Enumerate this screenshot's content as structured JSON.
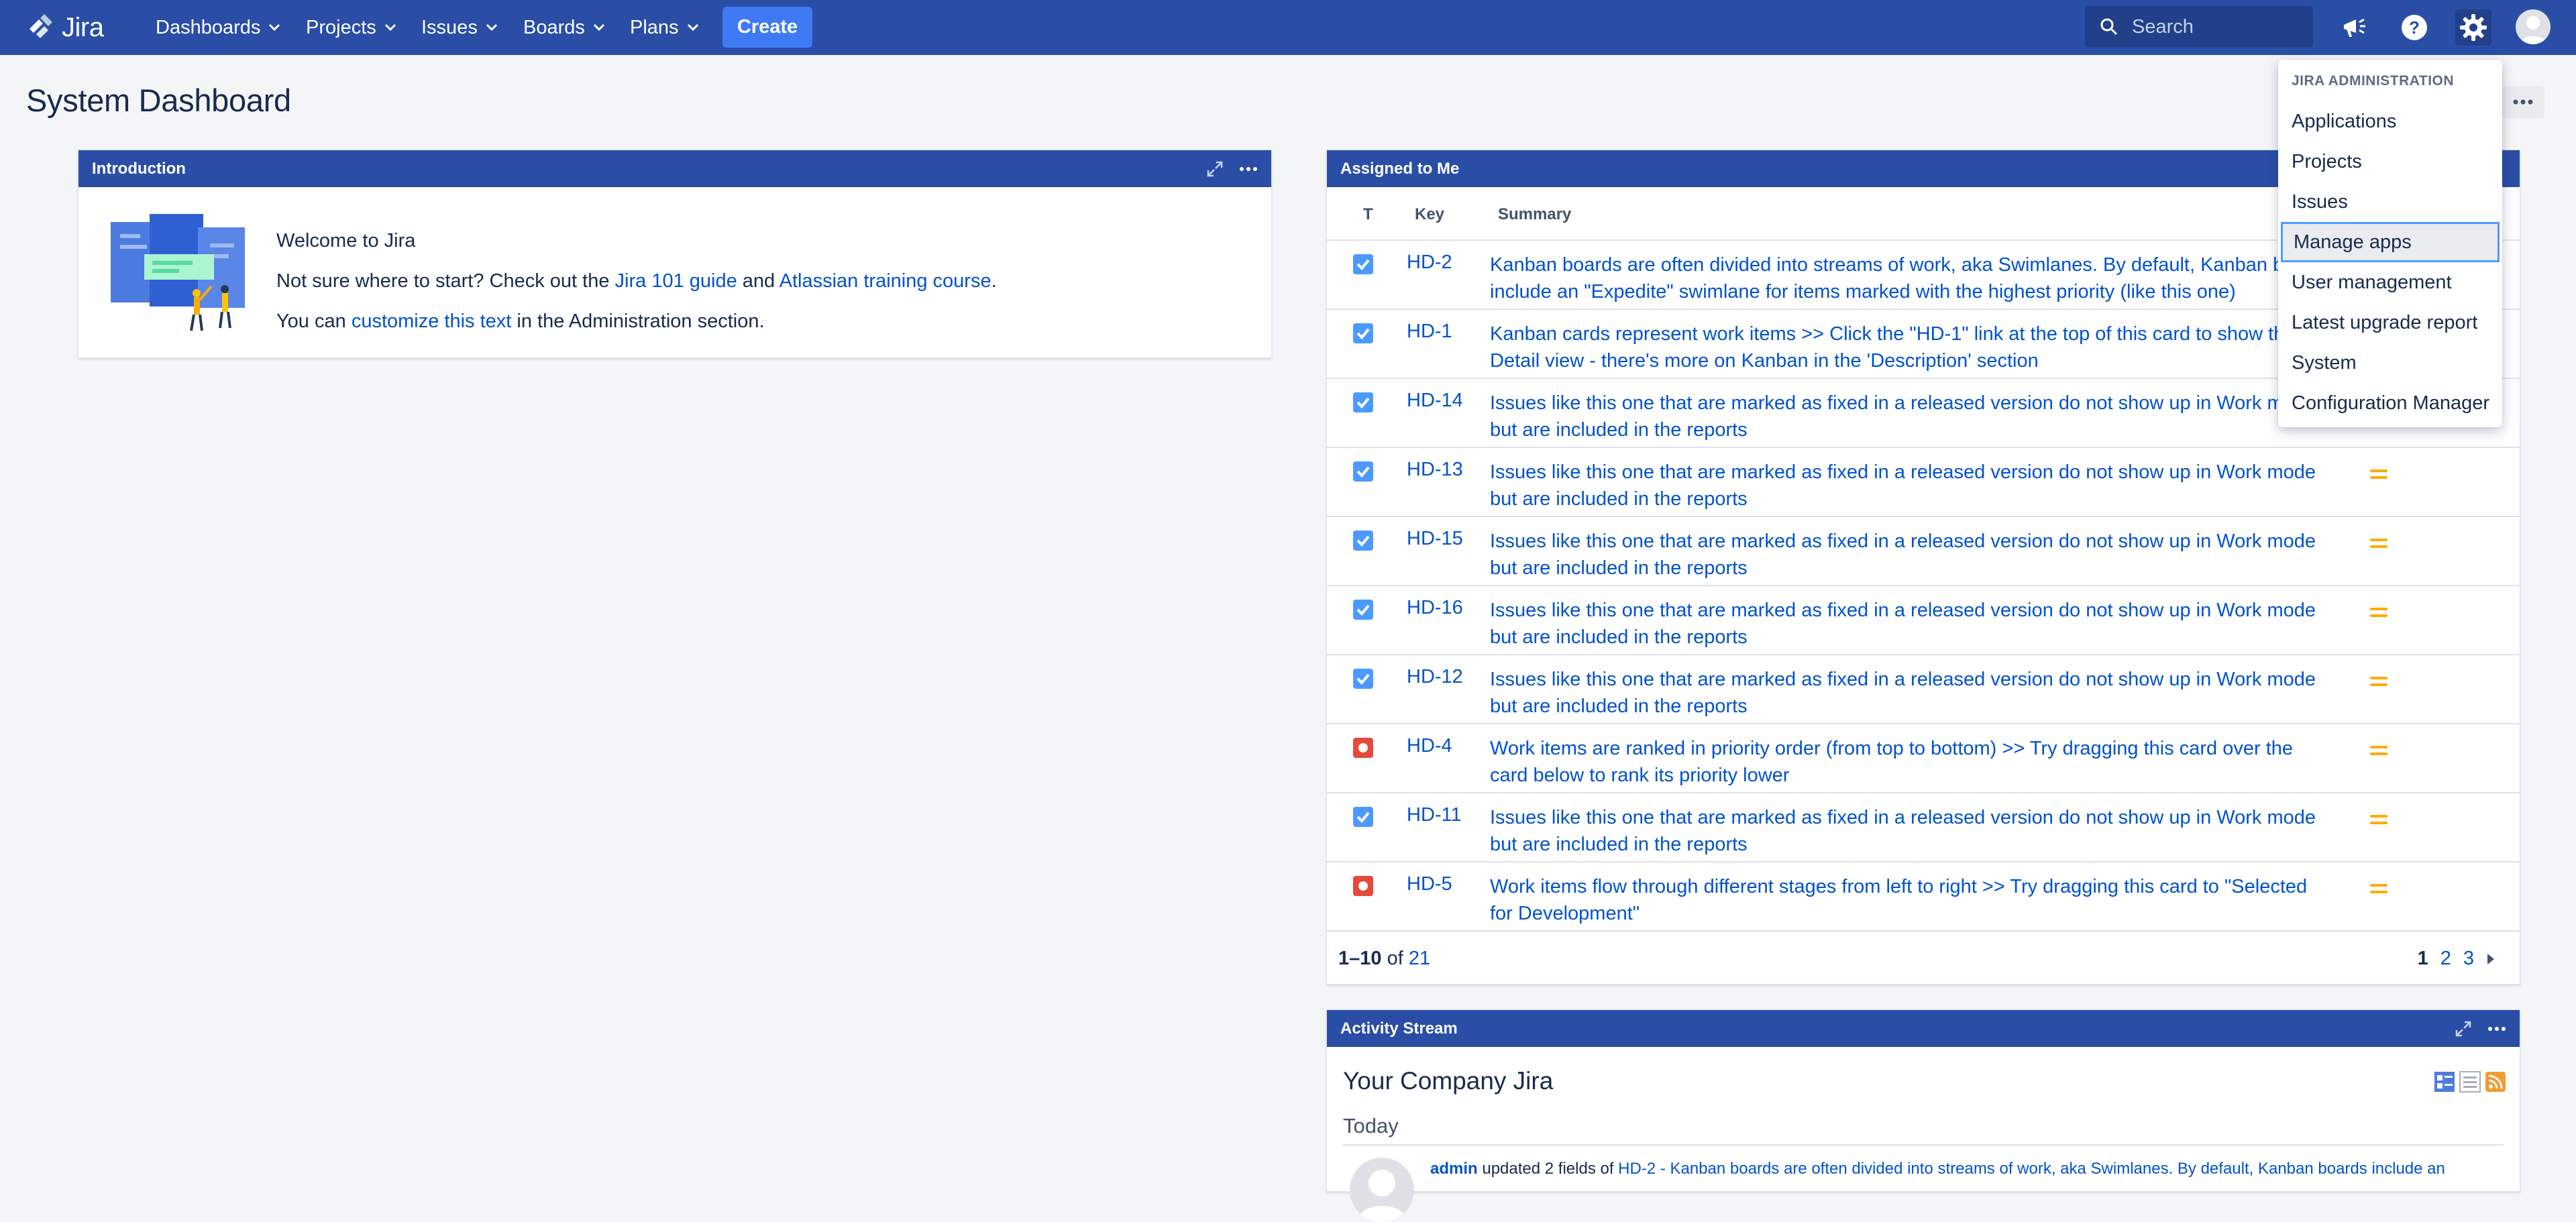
{
  "nav": {
    "product": "Jira",
    "items": [
      {
        "label": "Dashboards"
      },
      {
        "label": "Projects"
      },
      {
        "label": "Issues"
      },
      {
        "label": "Boards"
      },
      {
        "label": "Plans"
      }
    ],
    "create_label": "Create",
    "search_placeholder": "Search"
  },
  "page": {
    "title": "System Dashboard"
  },
  "introduction": {
    "title": "Introduction",
    "welcome": "Welcome to Jira",
    "line2_prefix": "Not sure where to start? Check out the ",
    "link_guide": "Jira 101 guide",
    "line2_mid": " and ",
    "link_training": "Atlassian training course",
    "line2_suffix": ".",
    "line3_prefix": "You can ",
    "link_customize": "customize this text",
    "line3_suffix": " in the Administration section."
  },
  "assigned": {
    "title": "Assigned to Me",
    "columns": {
      "type": "T",
      "key": "Key",
      "summary": "Summary"
    },
    "rows": [
      {
        "type": "task",
        "key": "HD-2",
        "summary": "Kanban boards are often divided into streams of work, aka Swimlanes. By default, Kanban boards include an \"Expedite\" swimlane for items marked with the highest priority (like this one)"
      },
      {
        "type": "task",
        "key": "HD-1",
        "summary": "Kanban cards represent work items >> Click the \"HD-1\" link at the top of this card to show the Detail view - there's more on Kanban in the 'Description' section"
      },
      {
        "type": "task",
        "key": "HD-14",
        "summary": "Issues like this one that are marked as fixed in a released version do not show up in Work mode but are included in the reports"
      },
      {
        "type": "task",
        "key": "HD-13",
        "summary": "Issues like this one that are marked as fixed in a released version do not show up in Work mode but are included in the reports"
      },
      {
        "type": "task",
        "key": "HD-15",
        "summary": "Issues like this one that are marked as fixed in a released version do not show up in Work mode but are included in the reports"
      },
      {
        "type": "task",
        "key": "HD-16",
        "summary": "Issues like this one that are marked as fixed in a released version do not show up in Work mode but are included in the reports"
      },
      {
        "type": "task",
        "key": "HD-12",
        "summary": "Issues like this one that are marked as fixed in a released version do not show up in Work mode but are included in the reports"
      },
      {
        "type": "bug",
        "key": "HD-4",
        "summary": "Work items are ranked in priority order (from top to bottom) >> Try dragging this card over the card below to rank its priority lower"
      },
      {
        "type": "task",
        "key": "HD-11",
        "summary": "Issues like this one that are marked as fixed in a released version do not show up in Work mode but are included in the reports"
      },
      {
        "type": "bug",
        "key": "HD-5",
        "summary": "Work items flow through different stages from left to right >> Try dragging this card to \"Selected for Development\""
      }
    ],
    "footer": {
      "range": "1–10",
      "of": " of ",
      "total": "21"
    },
    "pages": [
      "1",
      "2",
      "3"
    ]
  },
  "activity": {
    "title": "Activity Stream",
    "stream_title": "Your Company Jira",
    "today": "Today",
    "entry_user": "admin",
    "entry_action": " updated 2 fields of ",
    "entry_link": "HD-2 - Kanban boards are often divided into streams of work, aka Swimlanes. By default, Kanban boards include an"
  },
  "admin_menu": {
    "heading": "JIRA ADMINISTRATION",
    "items": [
      {
        "label": "Applications"
      },
      {
        "label": "Projects"
      },
      {
        "label": "Issues"
      },
      {
        "label": "Manage apps"
      },
      {
        "label": "User management"
      },
      {
        "label": "Latest upgrade report"
      },
      {
        "label": "System"
      },
      {
        "label": "Configuration Manager"
      }
    ],
    "highlighted": "Manage apps"
  },
  "colors": {
    "nav": "#2a4ea6",
    "create": "#3f7af5",
    "link": "#0052cc",
    "task_icon": "#4c9aff",
    "bug_icon": "#e5493a",
    "priority_medium": "#ffab00"
  },
  "icons": [
    "jira-logo-icon",
    "chevron-down-icon",
    "search-icon",
    "megaphone-icon",
    "help-icon",
    "gear-icon",
    "avatar-icon",
    "expand-icon",
    "more-icon",
    "task-icon",
    "bug-icon",
    "priority-medium-icon",
    "chevron-right-icon",
    "rss-icon"
  ]
}
